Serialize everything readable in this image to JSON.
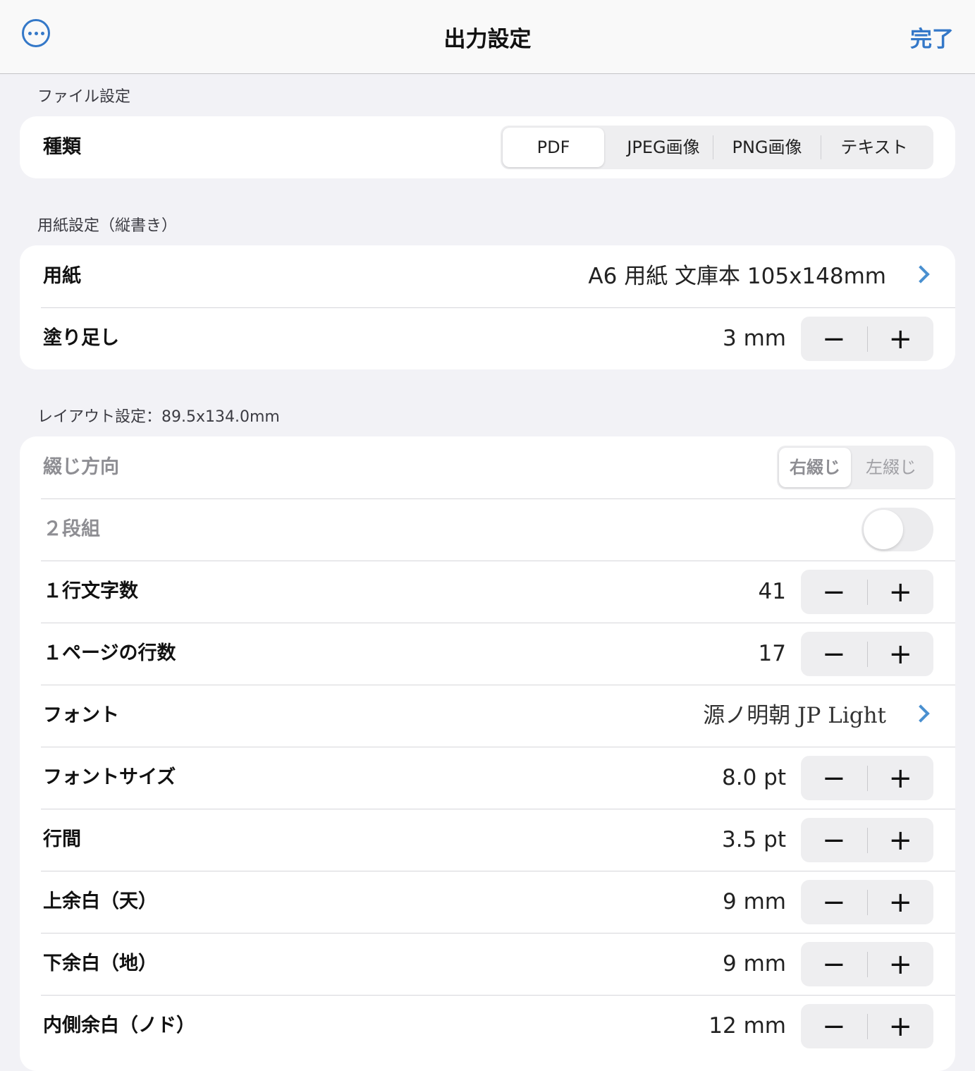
{
  "nav": {
    "title": "出力設定",
    "done_label": "完了",
    "more_icon": "ellipsis-circle-icon"
  },
  "file_section": {
    "header": "ファイル設定",
    "type_label": "種類",
    "type_options": [
      "PDF",
      "JPEG画像",
      "PNG画像",
      "テキスト"
    ],
    "type_selected": "PDF"
  },
  "paper_section": {
    "header": "用紙設定（縦書き）",
    "paper_label": "用紙",
    "paper_value": "A6 用紙 文庫本 105x148mm",
    "bleed_label": "塗り足し",
    "bleed_value": "3 mm"
  },
  "layout_section": {
    "header": "レイアウト設定：89.5x134.0mm",
    "binding_label": "綴じ方向",
    "binding_options": [
      "右綴じ",
      "左綴じ"
    ],
    "binding_selected": "右綴じ",
    "two_column_label": "２段組",
    "two_column_on": false,
    "chars_per_line_label": "１行文字数",
    "chars_per_line_value": "41",
    "lines_per_page_label": "１ページの行数",
    "lines_per_page_value": "17",
    "font_label": "フォント",
    "font_value": "源ノ明朝 JP Light",
    "font_size_label": "フォントサイズ",
    "font_size_value": "8.0 pt",
    "line_spacing_label": "行間",
    "line_spacing_value": "3.5 pt",
    "top_margin_label": "上余白（天）",
    "top_margin_value": "9 mm",
    "bottom_margin_label": "下余白（地）",
    "bottom_margin_value": "9 mm",
    "inner_margin_label": "内側余白（ノド）",
    "inner_margin_value": "12 mm"
  },
  "stepper": {
    "minus": "−",
    "plus": "+"
  }
}
